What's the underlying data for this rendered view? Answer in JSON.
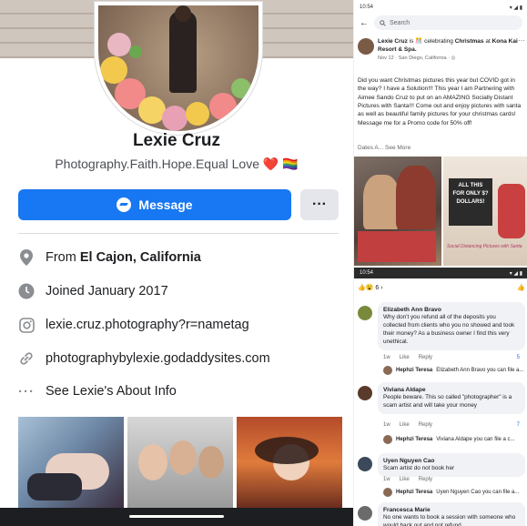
{
  "profile": {
    "name": "Lexie Cruz",
    "bio": "Photography.Faith.Hope.Equal Love",
    "bio_emoji_heart": "❤️",
    "bio_emoji_flag": "🏳️‍🌈",
    "message_label": "Message",
    "more_label": "···",
    "info": [
      {
        "icon": "location-pin-icon",
        "prefix": "From ",
        "bold": "El Cajon, California"
      },
      {
        "icon": "clock-icon",
        "prefix": "Joined January 2017",
        "bold": ""
      },
      {
        "icon": "instagram-icon",
        "prefix": "lexie.cruz.photography?r=nametag",
        "bold": ""
      },
      {
        "icon": "link-icon",
        "prefix": "photographybylexie.godaddysites.com",
        "bold": ""
      },
      {
        "icon": "more-dots-icon",
        "prefix": "See Lexie's About Info",
        "bold": ""
      }
    ]
  },
  "right": {
    "status_time_top": "10:54",
    "status_time_bottom": "10:54",
    "search_placeholder": "Search",
    "post": {
      "author": "Lexie Cruz",
      "verb": "is",
      "activity": "celebrating",
      "event": "Christmas",
      "at": "at",
      "place": "Kona Kai Resort & Spa.",
      "meta": "Nov 12 · San Diego, California · ",
      "body": "Did you want Christmas pictures this year but COVID got in the way? I have a Solution!!! This year I am Partnering with Aimee Sando Cruz to put on an AMAZING Socially Distant Pictures with Santa!!! Come out and enjoy pictures with santa as well as beautiful family pictures for your christmas cards! Message me for a Promo code for 50% off!",
      "dates": "Dates A...",
      "see_more": "See More",
      "img_text": "ALL THIS FOR ONLY $? DOLLARS!",
      "img_text2": "Social Distancing Pictures with Santa"
    },
    "reactions_count": "6",
    "comments": [
      {
        "name": "Elizabeth Ann Bravo",
        "text": "Why don't you refund all of the deposits you collected from clients who you no showed and took their money? As a business owner I find this very unethical.",
        "time": "1w",
        "like": "Like",
        "reply": "Reply",
        "count": "5",
        "reply_author": "Hephzi Teresa",
        "reply_text": "Elizabeth Ann Bravo you can file a...",
        "color": "#7a8a3c"
      },
      {
        "name": "Viviana Aldape",
        "text": "People beware. This so called \"photographer\" is a scam artist and will take your money",
        "time": "1w",
        "like": "Like",
        "reply": "Reply",
        "count": "7",
        "reply_author": "Hephzi Teresa",
        "reply_text": "Viviana Aldape you can file a c...",
        "color": "#5a3a2a"
      },
      {
        "name": "Uyen Nguyen Cao",
        "text": "Scam artist do not book her",
        "time": "1w",
        "like": "Like",
        "reply": "Reply",
        "count": "",
        "reply_author": "Hephzi Teresa",
        "reply_text": "Uyen Nguyen Cao you can file a...",
        "color": "#3b4a5a"
      },
      {
        "name": "Francesca Marie",
        "text": "No one wants to book a session with someone who would back out and not refund",
        "time": "",
        "like": "",
        "reply": "",
        "count": "",
        "reply_author": "",
        "reply_text": "",
        "color": "#6b6b6b"
      }
    ]
  }
}
